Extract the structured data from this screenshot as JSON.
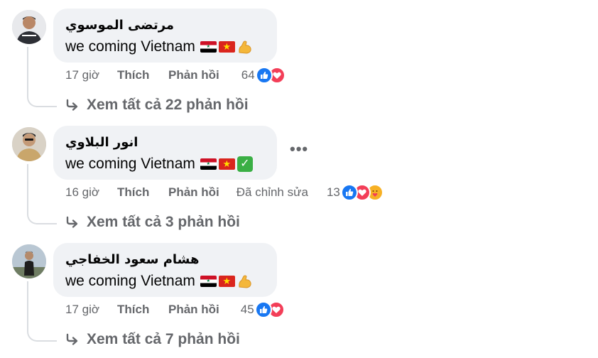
{
  "comments": [
    {
      "author": "مرتضى الموسوي",
      "text": "we coming Vietnam",
      "emojis": [
        "iraq-flag",
        "vietnam-flag",
        "flexed-biceps"
      ],
      "time": "17 giờ",
      "like_label": "Thích",
      "reply_label": "Phản hồi",
      "edited_label": "",
      "reaction_count": "64",
      "reactions": [
        "like",
        "love"
      ],
      "view_replies_label": "Xem tất cả 22 phản hồi",
      "has_more_menu": false,
      "avatar_color": "#2d2f35"
    },
    {
      "author": "انور البلاوي",
      "text": "we coming Vietnam",
      "emojis": [
        "iraq-flag",
        "vietnam-flag",
        "check-mark"
      ],
      "time": "16 giờ",
      "like_label": "Thích",
      "reply_label": "Phản hồi",
      "edited_label": "Đã chỉnh sửa",
      "reaction_count": "13",
      "reactions": [
        "like",
        "love",
        "care"
      ],
      "view_replies_label": "Xem tất cả 3 phản hồi",
      "has_more_menu": true,
      "more_label": "•••",
      "avatar_color": "#c9a66b"
    },
    {
      "author": "هشام سعود الخفاجي",
      "text": "we coming Vietnam",
      "emojis": [
        "iraq-flag",
        "vietnam-flag",
        "flexed-biceps"
      ],
      "time": "17 giờ",
      "like_label": "Thích",
      "reply_label": "Phản hồi",
      "edited_label": "",
      "reaction_count": "45",
      "reactions": [
        "like",
        "love"
      ],
      "view_replies_label": "Xem tất cả 7 phản hồi",
      "has_more_menu": false,
      "avatar_color": "#8fa3b5"
    }
  ],
  "colors": {
    "bubble_bg": "#f0f2f5",
    "secondary_text": "#65676b",
    "like_blue": "#1877f2",
    "love_red": "#f33e58",
    "care_yellow": "#f7b125"
  }
}
